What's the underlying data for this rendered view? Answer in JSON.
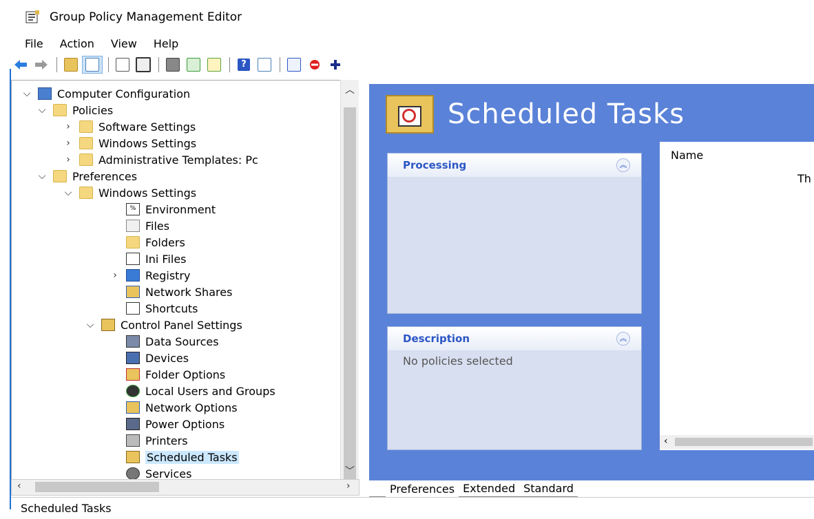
{
  "window": {
    "title": "Group Policy Management Editor"
  },
  "menu": [
    "File",
    "Action",
    "View",
    "Help"
  ],
  "toolbar": {
    "icons": [
      "back-icon",
      "forward-icon",
      "up-folder-icon",
      "show-hide-tree-icon",
      "copy-icon",
      "paste-icon",
      "print-icon",
      "refresh-icon",
      "export-icon",
      "help-icon",
      "show-hide-action-pane-icon",
      "properties-icon",
      "disable-icon",
      "add-icon"
    ]
  },
  "tree": {
    "nodes": [
      {
        "label": "Computer Configuration"
      },
      {
        "label": "Policies"
      },
      {
        "label": "Software Settings"
      },
      {
        "label": "Windows Settings"
      },
      {
        "label": "Administrative Templates: Pc"
      },
      {
        "label": "Preferences"
      },
      {
        "label": "Windows Settings"
      },
      {
        "label": "Environment"
      },
      {
        "label": "Files"
      },
      {
        "label": "Folders"
      },
      {
        "label": "Ini Files"
      },
      {
        "label": "Registry"
      },
      {
        "label": "Network Shares"
      },
      {
        "label": "Shortcuts"
      },
      {
        "label": "Control Panel Settings"
      },
      {
        "label": "Data Sources"
      },
      {
        "label": "Devices"
      },
      {
        "label": "Folder Options"
      },
      {
        "label": "Local Users and Groups"
      },
      {
        "label": "Network Options"
      },
      {
        "label": "Power Options"
      },
      {
        "label": "Printers"
      },
      {
        "label": "Scheduled Tasks"
      },
      {
        "label": "Services"
      }
    ]
  },
  "content": {
    "heading": "Scheduled Tasks",
    "processing": {
      "title": "Processing",
      "text": ""
    },
    "description": {
      "title": "Description",
      "text": "No policies selected"
    },
    "list": {
      "column_name": "Name",
      "message_partial": "Th"
    }
  },
  "tabs": [
    "Preferences",
    "Extended",
    "Standard"
  ],
  "status": {
    "text": "Scheduled Tasks"
  },
  "colors": {
    "accent_blue": "#5a82d8",
    "panel_bg": "#d8dff0",
    "selection": "#cce8ff"
  }
}
